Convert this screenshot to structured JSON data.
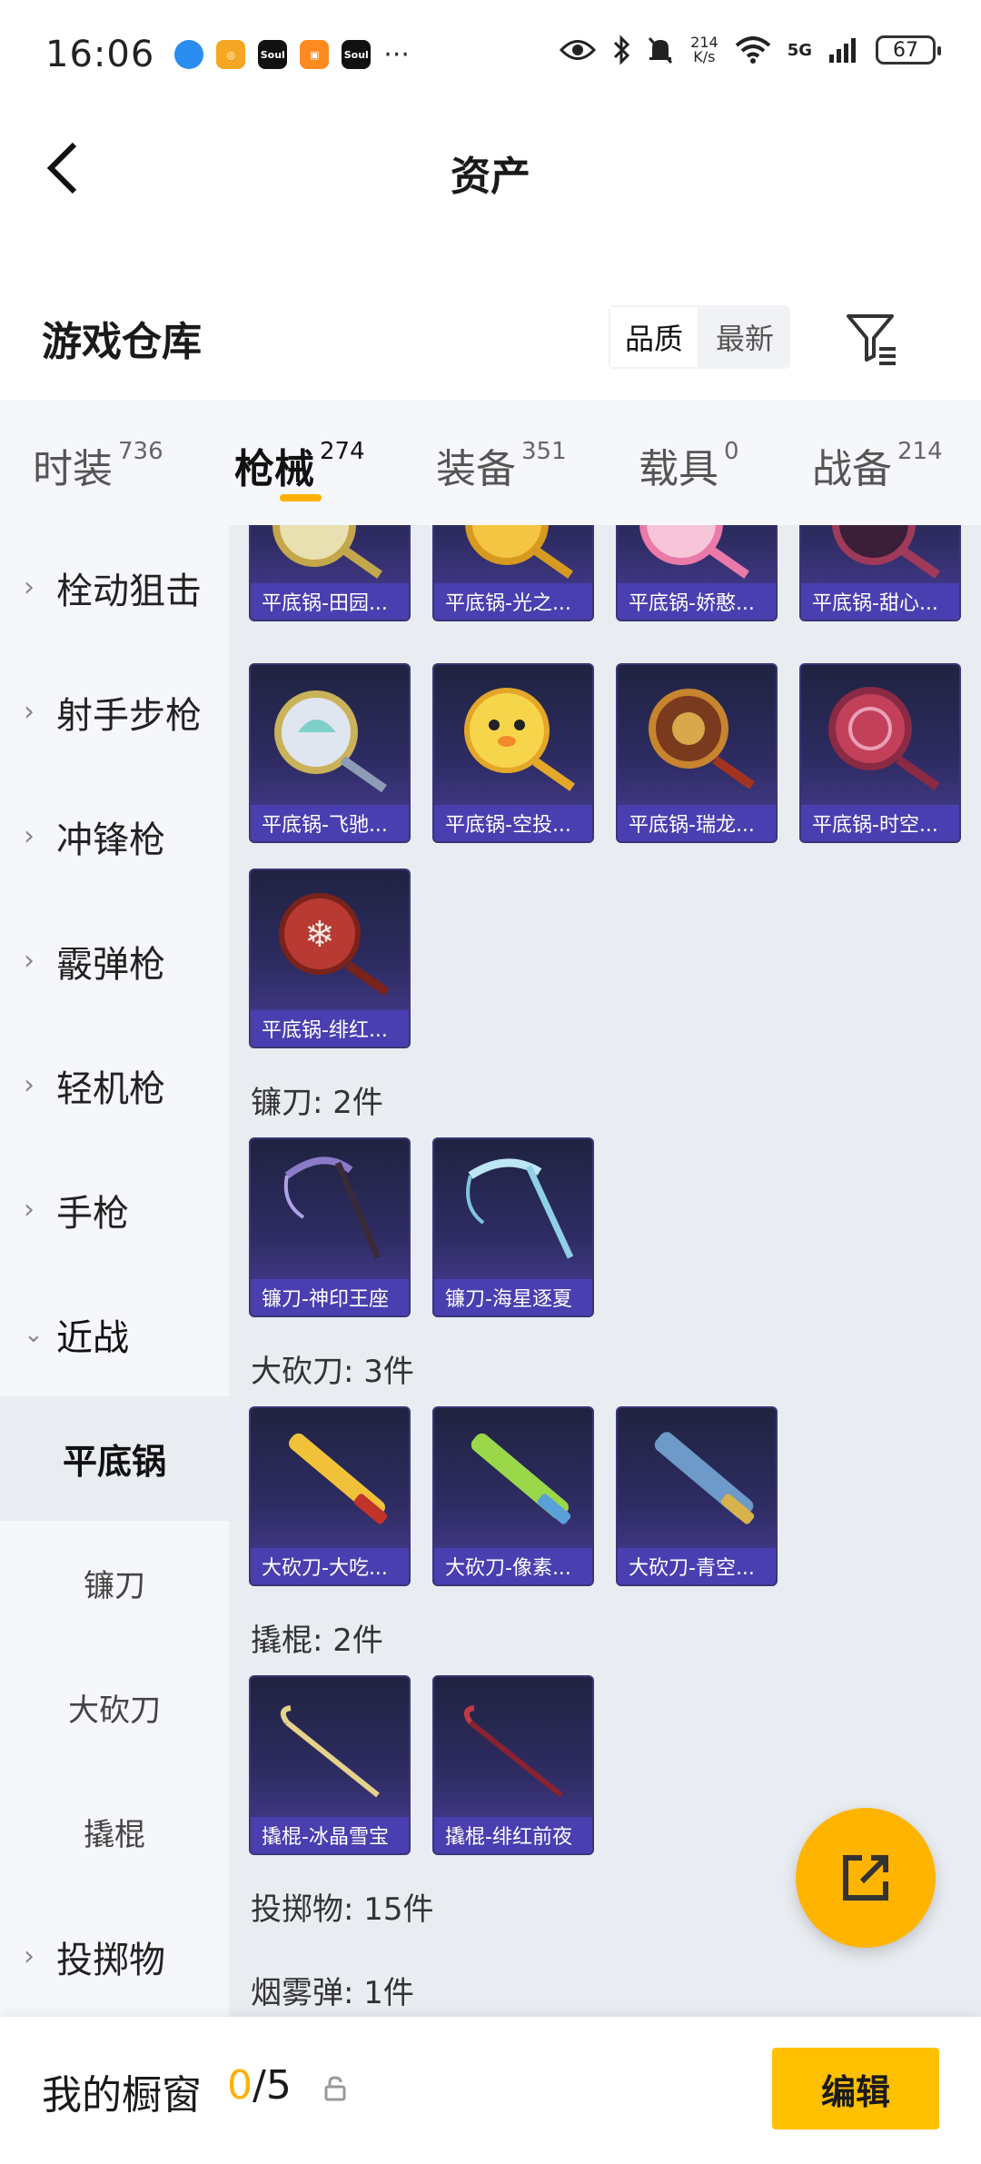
{
  "status_bar": {
    "time": "16:06",
    "apps": [
      "Soul",
      "Soul"
    ],
    "more": "···",
    "net_speed_top": "214",
    "net_speed_unit": "K/s",
    "network": "5G",
    "battery": "67"
  },
  "header": {
    "title": "资产"
  },
  "warehouse": {
    "title": "游戏仓库",
    "sort_quality": "品质",
    "sort_newest": "最新"
  },
  "tabs": [
    {
      "label": "时装",
      "count": "736"
    },
    {
      "label": "枪械",
      "count": "274"
    },
    {
      "label": "装备",
      "count": "351"
    },
    {
      "label": "载具",
      "count": "0"
    },
    {
      "label": "战备",
      "count": "214"
    }
  ],
  "sidebar": {
    "items": [
      {
        "label": "栓动狙击"
      },
      {
        "label": "射手步枪"
      },
      {
        "label": "冲锋枪"
      },
      {
        "label": "霰弹枪"
      },
      {
        "label": "轻机枪"
      },
      {
        "label": "手枪"
      },
      {
        "label": "近战"
      }
    ],
    "subitems": [
      {
        "label": "平底锅"
      },
      {
        "label": "镰刀"
      },
      {
        "label": "大砍刀"
      },
      {
        "label": "撬棍"
      }
    ],
    "last": {
      "label": "投掷物"
    }
  },
  "content": {
    "row1": [
      "平底锅-田园...",
      "平底锅-光之...",
      "平底锅-娇憨...",
      "平底锅-甜心..."
    ],
    "row2": [
      "平底锅-飞驰...",
      "平底锅-空投...",
      "平底锅-瑞龙...",
      "平底锅-时空..."
    ],
    "row3": [
      "平底锅-绯红..."
    ],
    "sickle_label": "镰刀: 2件",
    "sickle": [
      "镰刀-神印王座",
      "镰刀-海星逐夏"
    ],
    "machete_label": "大砍刀: 3件",
    "machete": [
      "大砍刀-大吃...",
      "大砍刀-像素...",
      "大砍刀-青空..."
    ],
    "crowbar_label": "撬棍: 2件",
    "crowbar": [
      "撬棍-冰晶雪宝",
      "撬棍-绯红前夜"
    ],
    "throwable_label": "投掷物: 15件",
    "smoke_label": "烟雾弹: 1件"
  },
  "bottom": {
    "title": "我的橱窗",
    "current": "0",
    "total": "/5",
    "edit_label": "编辑"
  },
  "colors": {
    "accent": "#ffb100",
    "card_bg": "#2e2c63",
    "card_label": "#4a3fb0"
  }
}
